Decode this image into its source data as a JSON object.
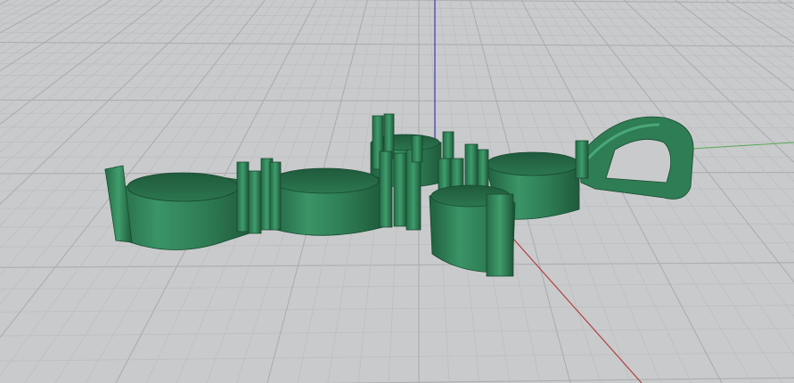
{
  "viewport": {
    "background_color": "#c9cacc",
    "grid_minor_color": "#bdbec1",
    "grid_major_color": "#acadb0",
    "axis_x_color": "#b04040",
    "axis_y_color": "#55aa55",
    "axis_z_color": "#3a3ab8"
  },
  "model": {
    "base_color": "#2f7d55",
    "light_color": "#3e9a6a",
    "dark_color": "#1d5a3b",
    "edge_color": "#174a30"
  }
}
